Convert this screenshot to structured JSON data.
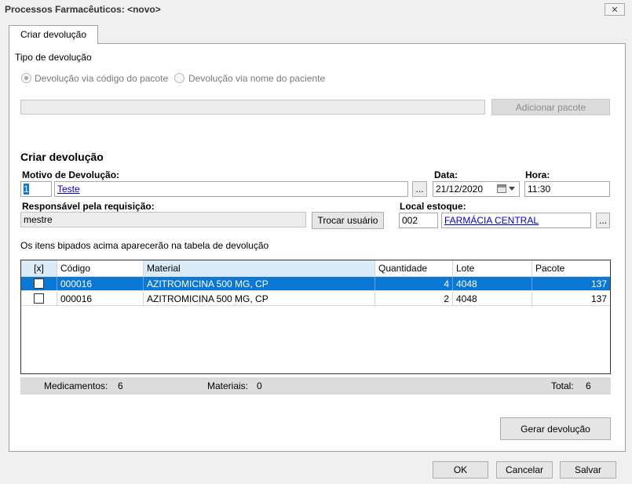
{
  "window": {
    "title": "Processos Farmacêuticos: <novo>",
    "close_glyph": "✕"
  },
  "tab": {
    "label": "Criar devolução"
  },
  "tipo": {
    "label": "Tipo de devolução",
    "option1": "Devolução via código do pacote",
    "option2": "Devolução via nome do paciente",
    "selected": "option1"
  },
  "pacote": {
    "value": "",
    "add_button": "Adicionar pacote"
  },
  "section": {
    "title": "Criar devolução"
  },
  "motivo": {
    "label": "Motivo de Devolução:",
    "code": "1",
    "text": "Teste",
    "lookup": "..."
  },
  "data_field": {
    "label": "Data:",
    "value": "21/12/2020"
  },
  "hora": {
    "label": "Hora:",
    "value": "11:30"
  },
  "responsavel": {
    "label": "Responsável pela requisição:",
    "value": "mestre",
    "button": "Trocar usuário"
  },
  "local": {
    "label": "Local estoque:",
    "code": "002",
    "text": "FARMÁCIA CENTRAL",
    "lookup": "..."
  },
  "info_text": "Os itens bipados acima aparecerão na tabela de devolução",
  "table": {
    "headers": [
      "[x]",
      "Código",
      "Material",
      "Quantidade",
      "Lote",
      "Pacote"
    ],
    "rows": [
      {
        "checked": false,
        "codigo": "000016",
        "material": "AZITROMICINA 500 MG, CP",
        "quantidade": "4",
        "lote": "4048",
        "pacote": "137",
        "selected": true
      },
      {
        "checked": false,
        "codigo": "000016",
        "material": "AZITROMICINA 500 MG, CP",
        "quantidade": "2",
        "lote": "4048",
        "pacote": "137",
        "selected": false
      }
    ]
  },
  "summary": {
    "medicamentos_label": "Medicamentos:",
    "medicamentos_value": "6",
    "materiais_label": "Materiais:",
    "materiais_value": "0",
    "total_label": "Total:",
    "total_value": "6"
  },
  "gerar_button": "Gerar devolução",
  "footer": {
    "ok": "OK",
    "cancel": "Cancelar",
    "save": "Salvar"
  }
}
